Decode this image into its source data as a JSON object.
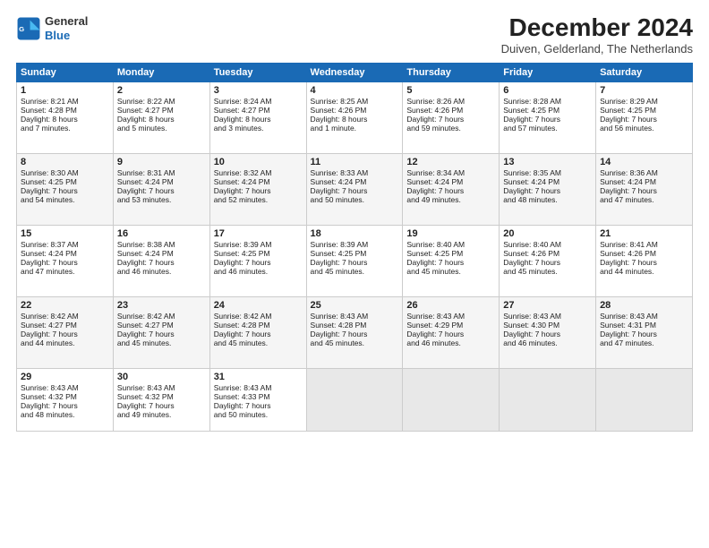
{
  "logo": {
    "line1": "General",
    "line2": "Blue"
  },
  "title": "December 2024",
  "subtitle": "Duiven, Gelderland, The Netherlands",
  "days_header": [
    "Sunday",
    "Monday",
    "Tuesday",
    "Wednesday",
    "Thursday",
    "Friday",
    "Saturday"
  ],
  "weeks": [
    [
      {
        "day": "1",
        "lines": [
          "Sunrise: 8:21 AM",
          "Sunset: 4:28 PM",
          "Daylight: 8 hours",
          "and 7 minutes."
        ]
      },
      {
        "day": "2",
        "lines": [
          "Sunrise: 8:22 AM",
          "Sunset: 4:27 PM",
          "Daylight: 8 hours",
          "and 5 minutes."
        ]
      },
      {
        "day": "3",
        "lines": [
          "Sunrise: 8:24 AM",
          "Sunset: 4:27 PM",
          "Daylight: 8 hours",
          "and 3 minutes."
        ]
      },
      {
        "day": "4",
        "lines": [
          "Sunrise: 8:25 AM",
          "Sunset: 4:26 PM",
          "Daylight: 8 hours",
          "and 1 minute."
        ]
      },
      {
        "day": "5",
        "lines": [
          "Sunrise: 8:26 AM",
          "Sunset: 4:26 PM",
          "Daylight: 7 hours",
          "and 59 minutes."
        ]
      },
      {
        "day": "6",
        "lines": [
          "Sunrise: 8:28 AM",
          "Sunset: 4:25 PM",
          "Daylight: 7 hours",
          "and 57 minutes."
        ]
      },
      {
        "day": "7",
        "lines": [
          "Sunrise: 8:29 AM",
          "Sunset: 4:25 PM",
          "Daylight: 7 hours",
          "and 56 minutes."
        ]
      }
    ],
    [
      {
        "day": "8",
        "lines": [
          "Sunrise: 8:30 AM",
          "Sunset: 4:25 PM",
          "Daylight: 7 hours",
          "and 54 minutes."
        ]
      },
      {
        "day": "9",
        "lines": [
          "Sunrise: 8:31 AM",
          "Sunset: 4:24 PM",
          "Daylight: 7 hours",
          "and 53 minutes."
        ]
      },
      {
        "day": "10",
        "lines": [
          "Sunrise: 8:32 AM",
          "Sunset: 4:24 PM",
          "Daylight: 7 hours",
          "and 52 minutes."
        ]
      },
      {
        "day": "11",
        "lines": [
          "Sunrise: 8:33 AM",
          "Sunset: 4:24 PM",
          "Daylight: 7 hours",
          "and 50 minutes."
        ]
      },
      {
        "day": "12",
        "lines": [
          "Sunrise: 8:34 AM",
          "Sunset: 4:24 PM",
          "Daylight: 7 hours",
          "and 49 minutes."
        ]
      },
      {
        "day": "13",
        "lines": [
          "Sunrise: 8:35 AM",
          "Sunset: 4:24 PM",
          "Daylight: 7 hours",
          "and 48 minutes."
        ]
      },
      {
        "day": "14",
        "lines": [
          "Sunrise: 8:36 AM",
          "Sunset: 4:24 PM",
          "Daylight: 7 hours",
          "and 47 minutes."
        ]
      }
    ],
    [
      {
        "day": "15",
        "lines": [
          "Sunrise: 8:37 AM",
          "Sunset: 4:24 PM",
          "Daylight: 7 hours",
          "and 47 minutes."
        ]
      },
      {
        "day": "16",
        "lines": [
          "Sunrise: 8:38 AM",
          "Sunset: 4:24 PM",
          "Daylight: 7 hours",
          "and 46 minutes."
        ]
      },
      {
        "day": "17",
        "lines": [
          "Sunrise: 8:39 AM",
          "Sunset: 4:25 PM",
          "Daylight: 7 hours",
          "and 46 minutes."
        ]
      },
      {
        "day": "18",
        "lines": [
          "Sunrise: 8:39 AM",
          "Sunset: 4:25 PM",
          "Daylight: 7 hours",
          "and 45 minutes."
        ]
      },
      {
        "day": "19",
        "lines": [
          "Sunrise: 8:40 AM",
          "Sunset: 4:25 PM",
          "Daylight: 7 hours",
          "and 45 minutes."
        ]
      },
      {
        "day": "20",
        "lines": [
          "Sunrise: 8:40 AM",
          "Sunset: 4:26 PM",
          "Daylight: 7 hours",
          "and 45 minutes."
        ]
      },
      {
        "day": "21",
        "lines": [
          "Sunrise: 8:41 AM",
          "Sunset: 4:26 PM",
          "Daylight: 7 hours",
          "and 44 minutes."
        ]
      }
    ],
    [
      {
        "day": "22",
        "lines": [
          "Sunrise: 8:42 AM",
          "Sunset: 4:27 PM",
          "Daylight: 7 hours",
          "and 44 minutes."
        ]
      },
      {
        "day": "23",
        "lines": [
          "Sunrise: 8:42 AM",
          "Sunset: 4:27 PM",
          "Daylight: 7 hours",
          "and 45 minutes."
        ]
      },
      {
        "day": "24",
        "lines": [
          "Sunrise: 8:42 AM",
          "Sunset: 4:28 PM",
          "Daylight: 7 hours",
          "and 45 minutes."
        ]
      },
      {
        "day": "25",
        "lines": [
          "Sunrise: 8:43 AM",
          "Sunset: 4:28 PM",
          "Daylight: 7 hours",
          "and 45 minutes."
        ]
      },
      {
        "day": "26",
        "lines": [
          "Sunrise: 8:43 AM",
          "Sunset: 4:29 PM",
          "Daylight: 7 hours",
          "and 46 minutes."
        ]
      },
      {
        "day": "27",
        "lines": [
          "Sunrise: 8:43 AM",
          "Sunset: 4:30 PM",
          "Daylight: 7 hours",
          "and 46 minutes."
        ]
      },
      {
        "day": "28",
        "lines": [
          "Sunrise: 8:43 AM",
          "Sunset: 4:31 PM",
          "Daylight: 7 hours",
          "and 47 minutes."
        ]
      }
    ],
    [
      {
        "day": "29",
        "lines": [
          "Sunrise: 8:43 AM",
          "Sunset: 4:32 PM",
          "Daylight: 7 hours",
          "and 48 minutes."
        ]
      },
      {
        "day": "30",
        "lines": [
          "Sunrise: 8:43 AM",
          "Sunset: 4:32 PM",
          "Daylight: 7 hours",
          "and 49 minutes."
        ]
      },
      {
        "day": "31",
        "lines": [
          "Sunrise: 8:43 AM",
          "Sunset: 4:33 PM",
          "Daylight: 7 hours",
          "and 50 minutes."
        ]
      },
      null,
      null,
      null,
      null
    ]
  ]
}
